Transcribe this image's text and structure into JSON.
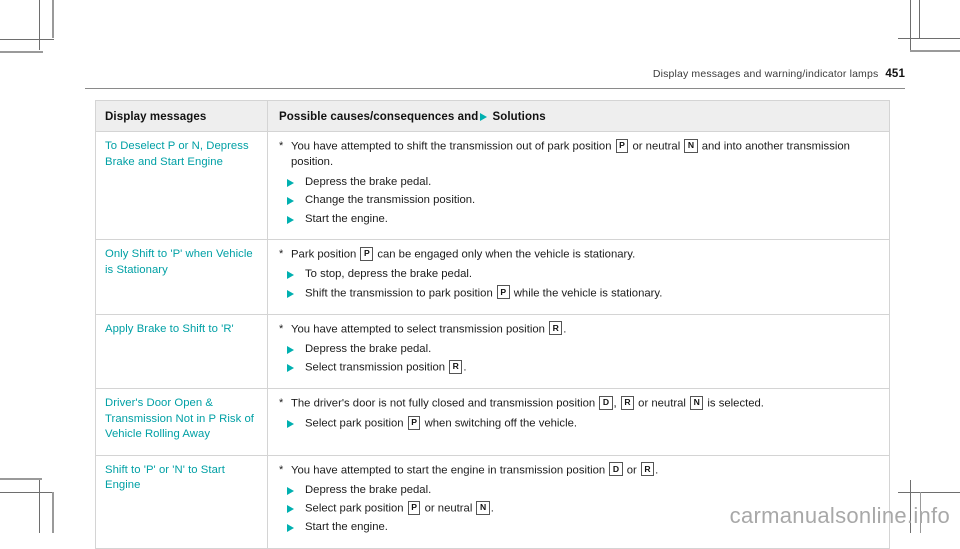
{
  "page": {
    "running_head": "Display messages and warning/indicator lamps",
    "page_number": "451",
    "watermark": "carmanualsonline.info",
    "accent_color": "#00a0a5",
    "bullet_color": "#00b0b0",
    "header_bg": "#eeeeee"
  },
  "table": {
    "header": {
      "col1": "Display messages",
      "col2_before": "Possible causes/consequences and",
      "col2_after": "Solutions"
    },
    "rows": [
      {
        "message": "To Deselect P or N, Depress Brake and Start Engine",
        "cause_parts": [
          {
            "t": "text",
            "v": "You have attempted to shift the transmission out of park position "
          },
          {
            "t": "gear",
            "v": "P"
          },
          {
            "t": "text",
            "v": " or neutral "
          },
          {
            "t": "gear",
            "v": "N"
          },
          {
            "t": "text",
            "v": " and into another transmission position."
          }
        ],
        "solutions": [
          [
            {
              "t": "text",
              "v": "Depress the brake pedal."
            }
          ],
          [
            {
              "t": "text",
              "v": "Change the transmission position."
            }
          ],
          [
            {
              "t": "text",
              "v": "Start the engine."
            }
          ]
        ]
      },
      {
        "message": "Only Shift to 'P' when Vehicle is Stationary",
        "cause_parts": [
          {
            "t": "text",
            "v": "Park position "
          },
          {
            "t": "gear",
            "v": "P"
          },
          {
            "t": "text",
            "v": " can be engaged only when the vehicle is stationary."
          }
        ],
        "solutions": [
          [
            {
              "t": "text",
              "v": "To stop, depress the brake pedal."
            }
          ],
          [
            {
              "t": "text",
              "v": "Shift the transmission to park position "
            },
            {
              "t": "gear",
              "v": "P"
            },
            {
              "t": "text",
              "v": " while the vehicle is stationary."
            }
          ]
        ]
      },
      {
        "message": "Apply Brake to Shift to 'R'",
        "cause_parts": [
          {
            "t": "text",
            "v": "You have attempted to select transmission position "
          },
          {
            "t": "gear",
            "v": "R"
          },
          {
            "t": "text",
            "v": "."
          }
        ],
        "solutions": [
          [
            {
              "t": "text",
              "v": "Depress the brake pedal."
            }
          ],
          [
            {
              "t": "text",
              "v": "Select transmission position "
            },
            {
              "t": "gear",
              "v": "R"
            },
            {
              "t": "text",
              "v": "."
            }
          ]
        ]
      },
      {
        "message": "Driver's Door Open & Transmission Not in P Risk of Vehicle Rolling Away",
        "cause_parts": [
          {
            "t": "text",
            "v": "The driver's door is not fully closed and transmission position "
          },
          {
            "t": "gear",
            "v": "D"
          },
          {
            "t": "text",
            "v": ", "
          },
          {
            "t": "gear",
            "v": "R"
          },
          {
            "t": "text",
            "v": " or neutral "
          },
          {
            "t": "gear",
            "v": "N"
          },
          {
            "t": "text",
            "v": " is selected."
          }
        ],
        "solutions": [
          [
            {
              "t": "text",
              "v": "Select park position "
            },
            {
              "t": "gear",
              "v": "P"
            },
            {
              "t": "text",
              "v": " when switching off the vehicle."
            }
          ]
        ]
      },
      {
        "message": "Shift to 'P' or 'N' to Start Engine",
        "cause_parts": [
          {
            "t": "text",
            "v": "You have attempted to start the engine in transmission position "
          },
          {
            "t": "gear",
            "v": "D"
          },
          {
            "t": "text",
            "v": " or "
          },
          {
            "t": "gear",
            "v": "R"
          },
          {
            "t": "text",
            "v": "."
          }
        ],
        "solutions": [
          [
            {
              "t": "text",
              "v": "Depress the brake pedal."
            }
          ],
          [
            {
              "t": "text",
              "v": "Select park position "
            },
            {
              "t": "gear",
              "v": "P"
            },
            {
              "t": "text",
              "v": " or neutral "
            },
            {
              "t": "gear",
              "v": "N"
            },
            {
              "t": "text",
              "v": "."
            }
          ],
          [
            {
              "t": "text",
              "v": "Start the engine."
            }
          ]
        ]
      }
    ],
    "star_mark": "*"
  }
}
